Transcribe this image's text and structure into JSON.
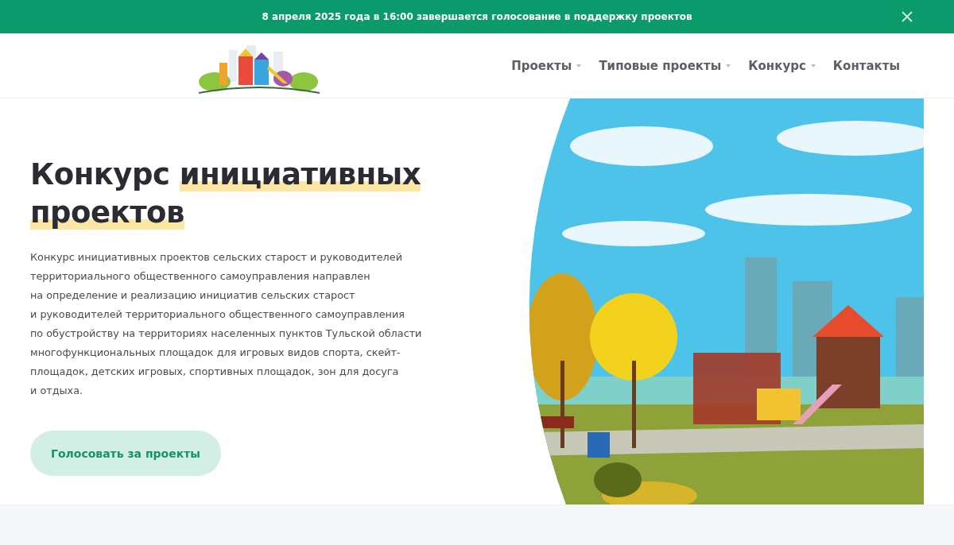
{
  "announcement": {
    "text": "8 апреля 2025 года в 16:00 завершается голосование в поддержку проектов"
  },
  "nav": [
    {
      "label": "Проекты",
      "has_dropdown": true
    },
    {
      "label": "Типовые проекты",
      "has_dropdown": true
    },
    {
      "label": "Конкурс",
      "has_dropdown": true
    },
    {
      "label": "Контакты",
      "has_dropdown": false
    }
  ],
  "hero": {
    "title": {
      "text": "Конкурс ",
      "highlight": "инициативных проектов"
    },
    "description": "Конкурс инициативных проектов сельских старост и руководителей\nтерриториального общественного самоуправления направлен\nна определение и реализацию инициатив сельских старост\nи руководителей территориального общественного самоуправления\nпо обустройству на территориях населенных пунктов Тульской области\nмногофункциональных площадок для игровых видов спорта, скейт-\nплощадок, детских игровых, спортивных площадок, зон для досуга\nи отдыха.",
    "button": "Голосовать за проекты"
  }
}
